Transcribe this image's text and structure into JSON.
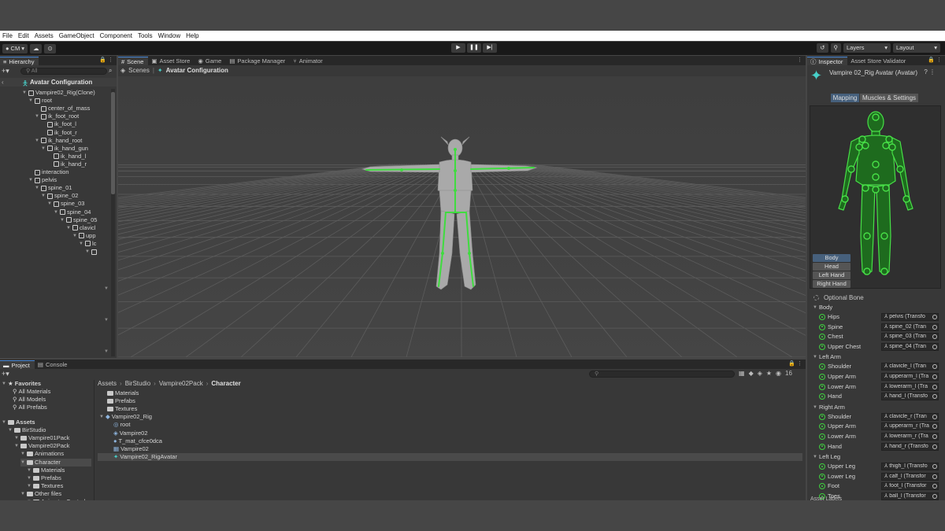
{
  "menu": [
    "File",
    "Edit",
    "Assets",
    "GameObject",
    "Component",
    "Tools",
    "Window",
    "Help"
  ],
  "toolbar": {
    "account": "CM",
    "layers": "Layers",
    "layout": "Layout"
  },
  "hierarchy": {
    "tab": "Hierarchy",
    "search_placeholder": "All",
    "root": "Avatar Configuration",
    "nodes": [
      {
        "label": "Vampire02_Rig(Clone)",
        "depth": 0,
        "icon": "cube-icon",
        "fold": true
      },
      {
        "label": "root",
        "depth": 1,
        "icon": "cube-icon",
        "fold": true
      },
      {
        "label": "center_of_mass",
        "depth": 2,
        "icon": "cube-icon",
        "fold": false
      },
      {
        "label": "ik_foot_root",
        "depth": 2,
        "icon": "cube-icon",
        "fold": true
      },
      {
        "label": "ik_foot_l",
        "depth": 3,
        "icon": "cube-icon",
        "fold": false
      },
      {
        "label": "ik_foot_r",
        "depth": 3,
        "icon": "cube-icon",
        "fold": false
      },
      {
        "label": "ik_hand_root",
        "depth": 2,
        "icon": "cube-icon",
        "fold": true
      },
      {
        "label": "ik_hand_gun",
        "depth": 3,
        "icon": "cube-icon",
        "fold": true
      },
      {
        "label": "ik_hand_l",
        "depth": 4,
        "icon": "cube-icon",
        "fold": false
      },
      {
        "label": "ik_hand_r",
        "depth": 4,
        "icon": "cube-icon",
        "fold": false
      },
      {
        "label": "interaction",
        "depth": 1,
        "icon": "cube-icon",
        "fold": false
      },
      {
        "label": "pelvis",
        "depth": 1,
        "icon": "cube-icon",
        "fold": true
      },
      {
        "label": "spine_01",
        "depth": 2,
        "icon": "cube-icon",
        "fold": true
      },
      {
        "label": "spine_02",
        "depth": 3,
        "icon": "cube-icon",
        "fold": true
      },
      {
        "label": "spine_03",
        "depth": 4,
        "icon": "cube-icon",
        "fold": true
      },
      {
        "label": "spine_04",
        "depth": 5,
        "icon": "cube-icon",
        "fold": true
      },
      {
        "label": "spine_05",
        "depth": 6,
        "icon": "cube-icon",
        "fold": true
      },
      {
        "label": "clavicl",
        "depth": 7,
        "icon": "cube-icon",
        "fold": true
      },
      {
        "label": "upp",
        "depth": 8,
        "icon": "cube-icon",
        "fold": true
      },
      {
        "label": "lc",
        "depth": 9,
        "icon": "cube-icon",
        "fold": true
      },
      {
        "label": "",
        "depth": 10,
        "icon": "cube-icon",
        "fold": true
      }
    ]
  },
  "scene": {
    "tabs": [
      "Scene",
      "Asset Store",
      "Game",
      "Package Manager",
      "Animator"
    ],
    "breadcrumb": [
      "Scenes",
      "Avatar Configuration"
    ]
  },
  "project": {
    "tabs": [
      "Project",
      "Console"
    ],
    "favorites": {
      "label": "Favorites",
      "items": [
        "All Materials",
        "All Models",
        "All Prefabs"
      ]
    },
    "assets_tree": [
      {
        "label": "Assets",
        "depth": 0,
        "bold": true
      },
      {
        "label": "BirStudio",
        "depth": 1
      },
      {
        "label": "Vampire01Pack",
        "depth": 2
      },
      {
        "label": "Vampire02Pack",
        "depth": 2
      },
      {
        "label": "Animations",
        "depth": 3
      },
      {
        "label": "Character",
        "depth": 3,
        "selected": true
      },
      {
        "label": "Materials",
        "depth": 4
      },
      {
        "label": "Prefabs",
        "depth": 4
      },
      {
        "label": "Textures",
        "depth": 4
      },
      {
        "label": "Other files",
        "depth": 3
      },
      {
        "label": "Animator Control",
        "depth": 4
      }
    ],
    "path": [
      "Assets",
      "BirStudio",
      "Vampire02Pack",
      "Character"
    ],
    "count": "16",
    "items": [
      {
        "label": "Materials",
        "depth": 0,
        "icon": "folder-icon"
      },
      {
        "label": "Prefabs",
        "depth": 0,
        "icon": "folder-icon"
      },
      {
        "label": "Textures",
        "depth": 0,
        "icon": "folder-icon"
      },
      {
        "label": "Vampire02_Rig",
        "depth": 0,
        "icon": "model-icon"
      },
      {
        "label": "root",
        "depth": 1,
        "icon": "transform-icon"
      },
      {
        "label": "Vampire02",
        "depth": 1,
        "icon": "mesh-icon"
      },
      {
        "label": "T_mat_cfce0dca",
        "depth": 1,
        "icon": "material-icon"
      },
      {
        "label": "Vampire02",
        "depth": 1,
        "icon": "grid-mesh-icon"
      },
      {
        "label": "Vampire02_RigAvatar",
        "depth": 1,
        "icon": "avatar-icon",
        "selected": true
      }
    ]
  },
  "inspector": {
    "tabs": [
      "Inspector",
      "Asset Store Validator"
    ],
    "title": "Vampire 02_Rig Avatar (Avatar)",
    "mode_tabs": [
      "Mapping",
      "Muscles & Settings"
    ],
    "body_buttons": [
      "Body",
      "Head",
      "Left Hand",
      "Right Hand"
    ],
    "optional_bone": "Optional Bone",
    "groups": [
      {
        "name": "Body",
        "bones": [
          {
            "label": "Hips",
            "value": "pelvis (Transfo"
          },
          {
            "label": "Spine",
            "value": "spine_02 (Tran"
          },
          {
            "label": "Chest",
            "value": "spine_03 (Tran"
          },
          {
            "label": "Upper Chest",
            "value": "spine_04 (Tran"
          }
        ]
      },
      {
        "name": "Left Arm",
        "bones": [
          {
            "label": "Shoulder",
            "value": "clavicle_l (Tran"
          },
          {
            "label": "Upper Arm",
            "value": "upperarm_l (Tra"
          },
          {
            "label": "Lower Arm",
            "value": "lowerarm_l (Tra"
          },
          {
            "label": "Hand",
            "value": "hand_l (Transfo"
          }
        ]
      },
      {
        "name": "Right Arm",
        "bones": [
          {
            "label": "Shoulder",
            "value": "clavicle_r (Tran"
          },
          {
            "label": "Upper Arm",
            "value": "upperarm_r (Tra"
          },
          {
            "label": "Lower Arm",
            "value": "lowerarm_r (Tra"
          },
          {
            "label": "Hand",
            "value": "hand_r (Transfo"
          }
        ]
      },
      {
        "name": "Left Leg",
        "bones": [
          {
            "label": "Upper Leg",
            "value": "thigh_l (Transfo"
          },
          {
            "label": "Lower Leg",
            "value": "calf_l (Transfor"
          },
          {
            "label": "Foot",
            "value": "foot_l (Transfor"
          },
          {
            "label": "Toes",
            "value": "ball_l (Transfor"
          }
        ]
      }
    ],
    "footer_label": "Asset Labels"
  },
  "colors": {
    "accent": "#4a8ad8",
    "bone_green": "#3fcf3f",
    "selection": "#2c5d87"
  }
}
